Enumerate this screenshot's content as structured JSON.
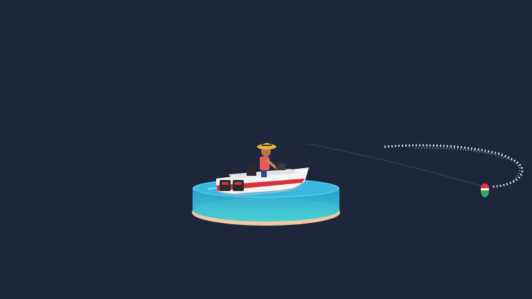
{
  "scene": {
    "background_color": "#1d263a",
    "water_colors": [
      "#5fd3e6",
      "#2aa9d2",
      "#1f8fc2"
    ],
    "sand_color": "#f2c9a0",
    "boat_hull_color": "#f4f4f4",
    "boat_stripe_color": "#d8323a",
    "motor_color": "#2a2a2e",
    "fisher_shirt_color": "#e35a5a",
    "fisher_hat_color": "#e8b13a",
    "float_colors": [
      "#e23a3a",
      "#3aa85a"
    ],
    "splash_color": "#ffffff"
  },
  "icons": {
    "water_disc": "water-disc-icon",
    "boat": "fishing-boat-icon",
    "fisherman": "fisherman-icon",
    "rod": "fishing-rod-icon",
    "line": "fishing-line-icon",
    "bobber": "bobber-icon",
    "splash": "splash-trail-icon"
  }
}
